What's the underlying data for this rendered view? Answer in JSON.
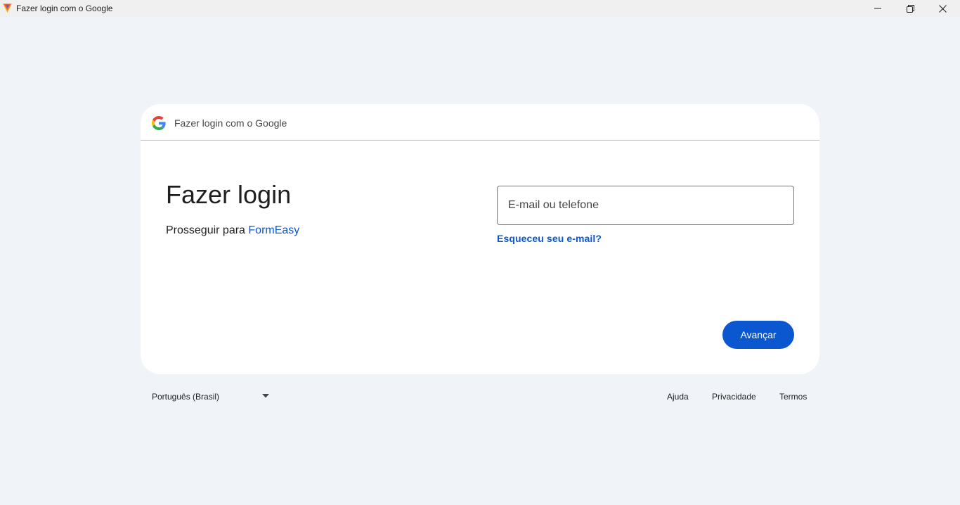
{
  "window": {
    "title": "Fazer login com o Google",
    "app_icon": "formeasy-app-icon",
    "controls": {
      "minimize": "minimize-icon",
      "maximize": "restore-icon",
      "close": "close-icon"
    }
  },
  "card": {
    "header_text": "Fazer login com o Google",
    "logo": "google-g-logo",
    "heading": "Fazer login",
    "subtitle_prefix": "Prosseguir para",
    "subtitle_app": "FormEasy",
    "email_placeholder": "E-mail ou telefone",
    "email_value": "",
    "forgot_email": "Esqueceu seu e-mail?",
    "next_button": "Avançar"
  },
  "footer": {
    "language": "Português (Brasil)",
    "links": [
      "Ajuda",
      "Privacidade",
      "Termos"
    ]
  },
  "colors": {
    "accent": "#0b57d0",
    "page_background": "#f0f4f9",
    "card_background": "#ffffff"
  }
}
